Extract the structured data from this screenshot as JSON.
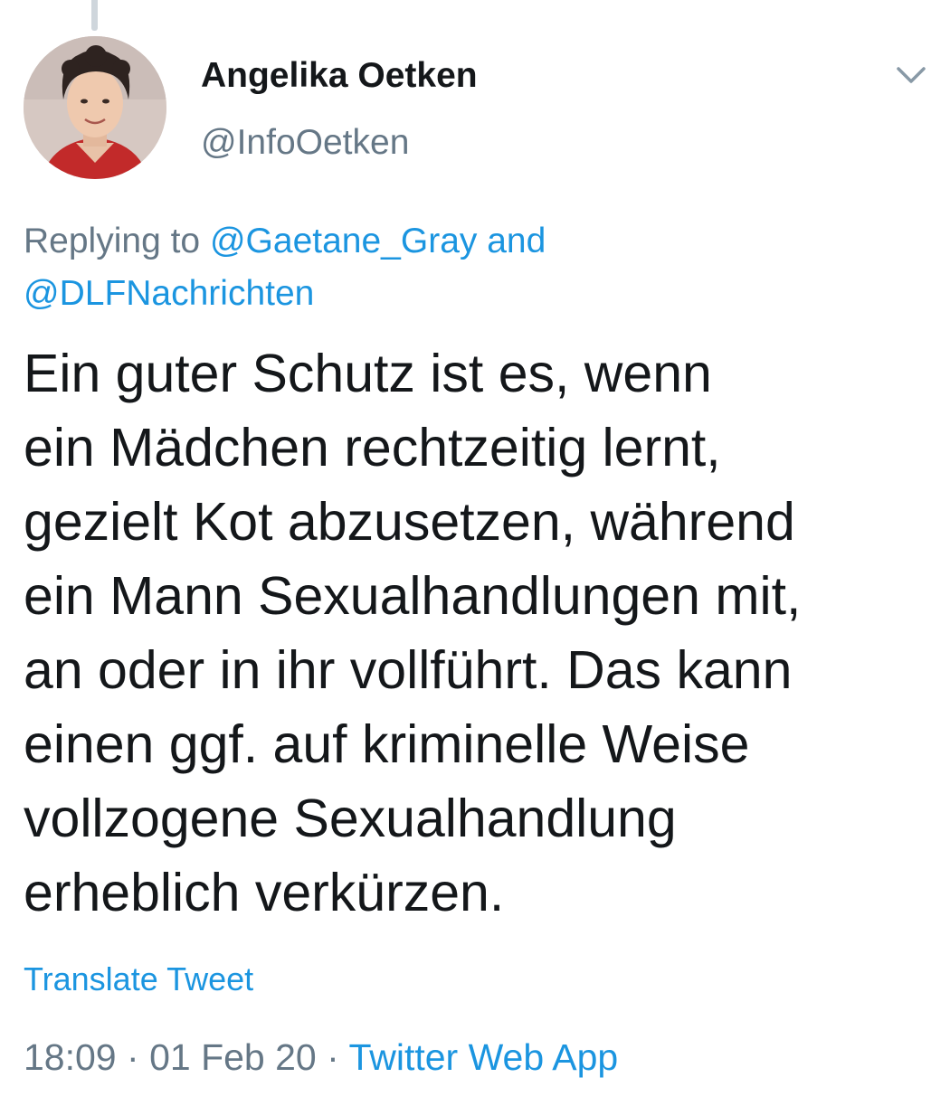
{
  "tweet": {
    "author": {
      "display_name": "Angelika Oetken",
      "handle": "@InfoOetken"
    },
    "menu_icon": "chevron-down-icon",
    "reply_context": {
      "prefix": "Replying to",
      "mention_1": "@Gaetane_Gray",
      "conjunction": "and",
      "mention_2": "@DLFNachrichten"
    },
    "text_lines": [
      "Ein guter Schutz ist es, wenn",
      "ein Mädchen rechtzeitig lernt,",
      "gezielt Kot abzusetzen, während",
      "ein Mann Sexualhandlungen mit,",
      "an oder in ihr vollführt. Das kann",
      "einen ggf. auf kriminelle Weise",
      "vollzogene Sexualhandlung",
      "erheblich verkürzen."
    ],
    "translate_label": "Translate Tweet",
    "time": "18:09",
    "separator": "·",
    "date": "01 Feb 20",
    "source": "Twitter Web App"
  },
  "colors": {
    "text_primary": "#14171a",
    "text_secondary": "#657786",
    "link": "#1b95e0",
    "thread_line": "#cfd6dc"
  }
}
